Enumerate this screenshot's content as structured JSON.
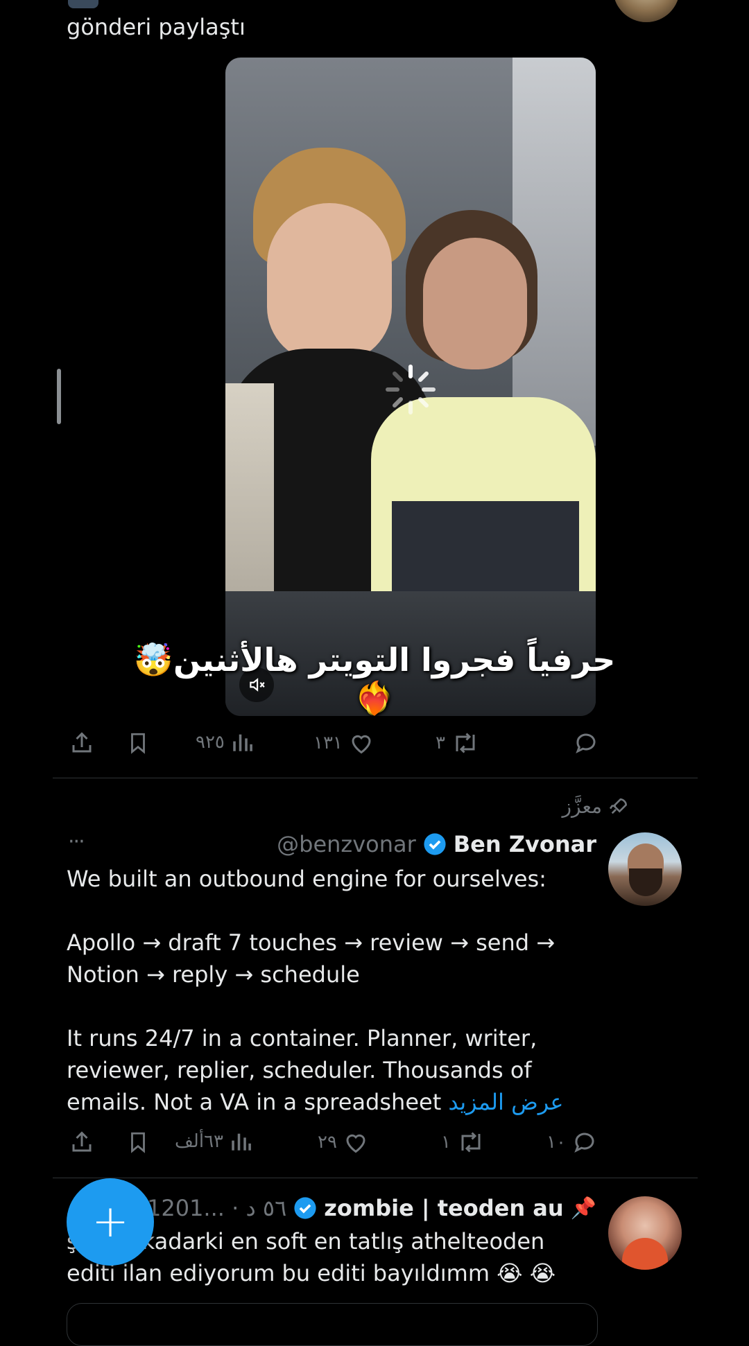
{
  "post1": {
    "context_text": "gönderi paylaştı",
    "video_caption": "حرفياً فجروا التويتر هالأثنين🤯❤️‍🔥",
    "stats": {
      "views": "٩٢٥",
      "likes": "١٣١",
      "reposts": "٣",
      "replies": ""
    }
  },
  "post2": {
    "promoted_label": "معزَّز",
    "author_name": "Ben Zvonar",
    "author_handle": "@benzvonar",
    "more": "···",
    "body_lines": [
      "We built an outbound engine for ourselves:",
      "",
      "Apollo → draft 7 touches → review → send →",
      "Notion → reply → schedule",
      "",
      "It runs 24/7 in a container. Planner, writer,",
      "reviewer, replier, scheduler. Thousands of",
      "emails. Not a VA in a spreadsheet"
    ],
    "show_more": "عرض المزيد",
    "stats": {
      "views": "٦٣ألف",
      "likes": "٢٩",
      "reposts": "١",
      "replies": "١٠"
    }
  },
  "post3": {
    "author_name": "zombie | teoden au",
    "pin_emoji": "📌",
    "handle_time": "@1201... · ٥٦ د",
    "line1": "kadarki en soft en tatlış athelteoden",
    "line1_prefix": "ş",
    "line2": "editi ilan ediyorum bu editi bayıldımm 😭 😭"
  },
  "fab": {
    "label": "+"
  },
  "colors": {
    "accent": "#1d9bf0",
    "background": "#000000",
    "muted": "#71767b"
  }
}
